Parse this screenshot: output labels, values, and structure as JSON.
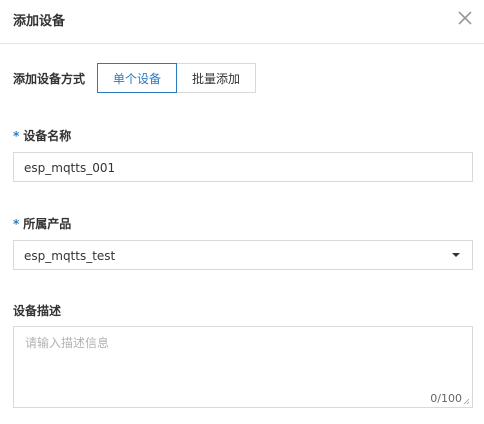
{
  "dialog": {
    "title": "添加设备",
    "icons": {
      "close": "close-icon",
      "select": "chevron-down-icon",
      "resize": "resize-handle-icon"
    },
    "colors": {
      "accent": "#2a7ac0",
      "border": "#d9d9d9",
      "placeholder": "#b3b3b3"
    }
  },
  "mode": {
    "label": "添加设备方式",
    "options": [
      "单个设备",
      "批量添加"
    ],
    "selected": "单个设备"
  },
  "device_name": {
    "required_mark": "*",
    "label": "设备名称",
    "value": "esp_mqtts_001"
  },
  "product": {
    "required_mark": "*",
    "label": "所属产品",
    "value": "esp_mqtts_test"
  },
  "description": {
    "label": "设备描述",
    "placeholder": "请输入描述信息",
    "counter": "0/100"
  }
}
